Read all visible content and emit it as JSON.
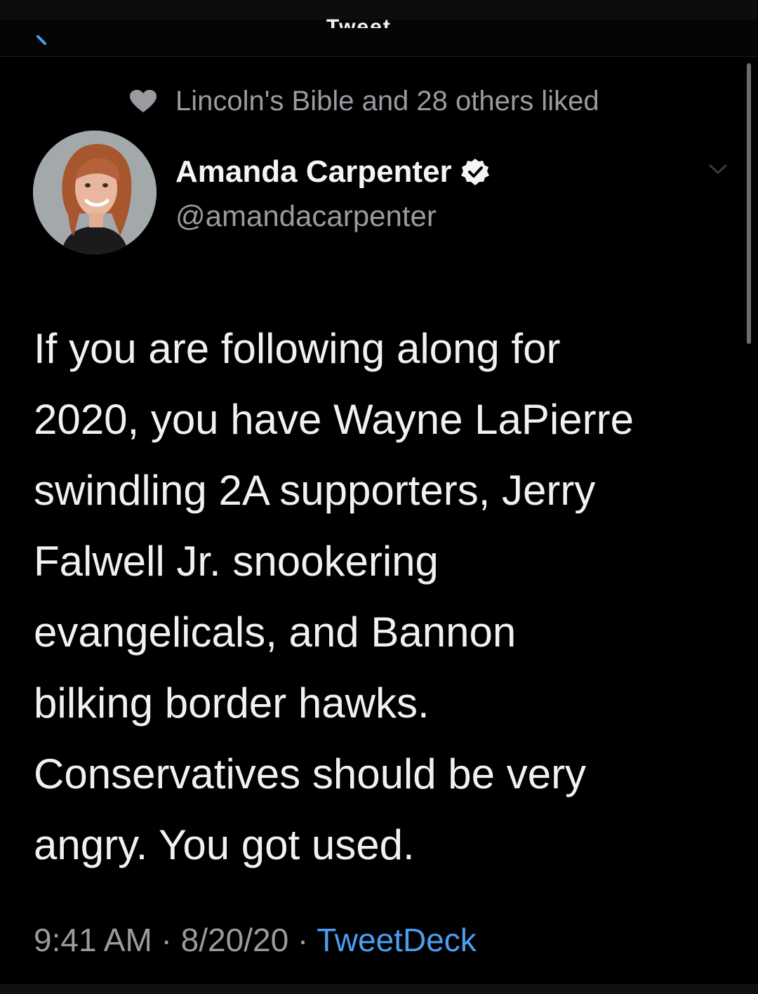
{
  "nav": {
    "title": "Tweet"
  },
  "social_context": {
    "liked_text": "Lincoln's Bible and 28 others liked"
  },
  "author": {
    "name": "Amanda Carpenter",
    "handle": "@amandacarpenter",
    "verified": true
  },
  "tweet": {
    "text": "If you are following along for\n2020, you have Wayne LaPierre\nswindling 2A supporters, Jerry\nFalwell Jr. snookering\nevangelicals, and Bannon\nbilking border hawks.\nConservatives should be very\nangry. You got used."
  },
  "meta": {
    "time": "9:41 AM",
    "separator": " · ",
    "date": "8/20/20",
    "source": "TweetDeck"
  },
  "icons": {
    "back": "back-arrow-icon",
    "heart": "heart-icon",
    "verified": "verified-badge-icon",
    "more": "chevron-down-icon"
  },
  "colors": {
    "background": "#000000",
    "text": "#f1f1f1",
    "muted": "#9a9aa0",
    "link": "#4a9ff2"
  }
}
